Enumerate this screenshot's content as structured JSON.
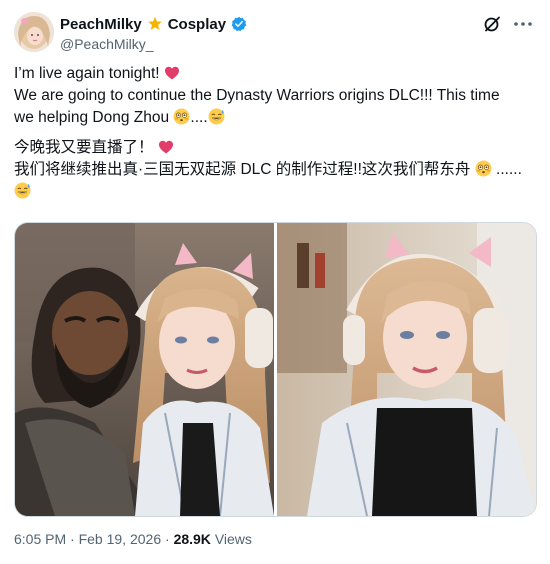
{
  "author": {
    "display_name": "PeachMilky",
    "display_suffix": "Cosplay",
    "handle": "@PeachMilky_",
    "avatar": "avatar-photo"
  },
  "icons": {
    "badge": "star-badge-icon",
    "verified": "verified-check-icon",
    "grok": "grok-icon",
    "more": "more-options-icon"
  },
  "tweet": {
    "line1": "I’m live again tonight!",
    "line2": "We are going to continue the Dynasty Warriors origins DLC!!! This time",
    "line3a": "we helping Dong Zhou",
    "line3b": "....",
    "line4": "今晚我又要直播了！",
    "line5a": "我们将继续推出真·三国无双起源 DLC 的制作过程!!这次我们帮东舟",
    "line5b": "......"
  },
  "media": {
    "left_image": "cosplayer-with-game-character-photo",
    "right_image": "cosplayer-portrait-photo"
  },
  "meta": {
    "time": "6:05 PM",
    "sep1": "·",
    "date": "Feb 19, 2026",
    "sep2": "·",
    "views_count": "28.9K",
    "views_label": "Views"
  },
  "colors": {
    "accent": "#1d9bf0",
    "badge": "#f4b400",
    "text": "#0f1419",
    "muted": "#536471"
  }
}
